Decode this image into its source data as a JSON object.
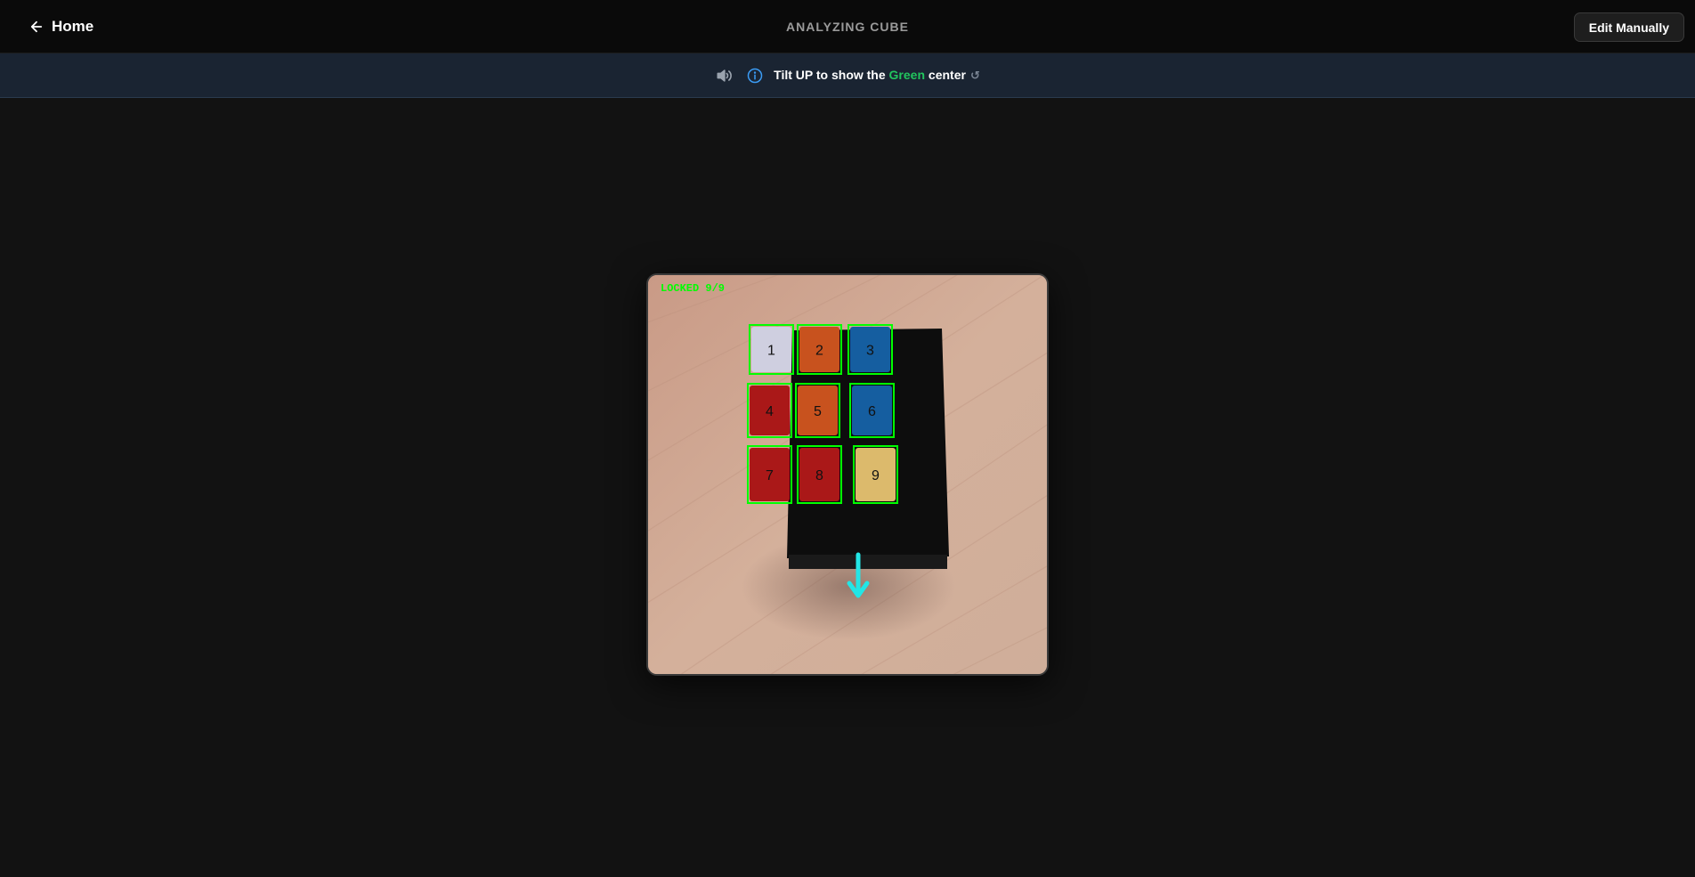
{
  "header": {
    "home_label": "Home",
    "title": "ANALYZING CUBE",
    "edit_label": "Edit Manually"
  },
  "banner": {
    "instruction_prefix": "Tilt UP to show the ",
    "instruction_highlight": "Green",
    "instruction_suffix": " center",
    "highlight_color": "#22c55e",
    "icons": [
      "speaker-icon",
      "info-icon",
      "replay-icon"
    ]
  },
  "camera": {
    "status_text": "LOCKED 9/9",
    "status_color": "#00ff00",
    "detection_color": "#00ff00",
    "arrow_color": "#22e6e6",
    "stickers": [
      {
        "label": "1",
        "color": "#cfcfe0"
      },
      {
        "label": "2",
        "color": "#c8521e"
      },
      {
        "label": "3",
        "color": "#155ea0"
      },
      {
        "label": "4",
        "color": "#aa1818"
      },
      {
        "label": "5",
        "color": "#c8521e"
      },
      {
        "label": "6",
        "color": "#155ea0"
      },
      {
        "label": "7",
        "color": "#aa1818"
      },
      {
        "label": "8",
        "color": "#aa1818"
      },
      {
        "label": "9",
        "color": "#dcba6c"
      }
    ]
  }
}
